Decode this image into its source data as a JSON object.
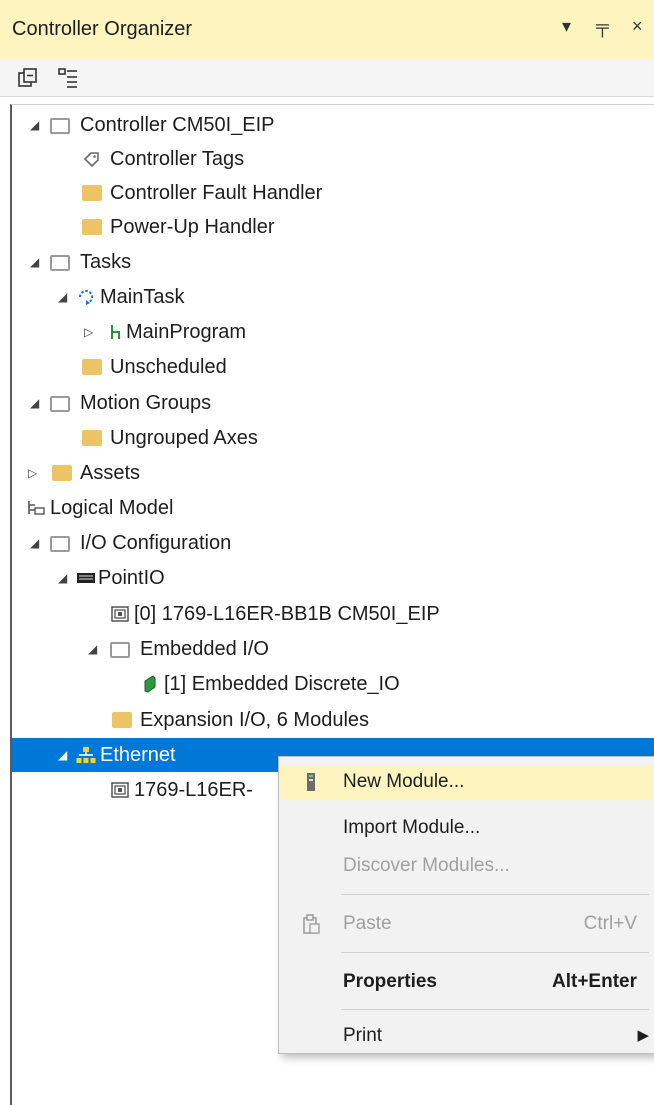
{
  "panel": {
    "title": "Controller Organizer",
    "controls": {
      "dropdown": "▾",
      "pin": "╤",
      "close": "×"
    }
  },
  "tree": [
    {
      "label": "Controller CM50I_EIP",
      "icon": "folder-open-icon",
      "expander": "expanded"
    },
    {
      "label": "Controller Tags",
      "icon": "tag-icon"
    },
    {
      "label": "Controller Fault Handler",
      "icon": "folder-icon"
    },
    {
      "label": "Power-Up Handler",
      "icon": "folder-icon"
    },
    {
      "label": "Tasks",
      "icon": "folder-open-icon",
      "expander": "expanded"
    },
    {
      "label": "MainTask",
      "icon": "continuous-task-icon",
      "expander": "expanded"
    },
    {
      "label": "MainProgram",
      "icon": "program-icon",
      "expander": "collapsed"
    },
    {
      "label": "Unscheduled",
      "icon": "folder-icon"
    },
    {
      "label": "Motion Groups",
      "icon": "folder-open-icon",
      "expander": "expanded"
    },
    {
      "label": "Ungrouped Axes",
      "icon": "folder-icon"
    },
    {
      "label": "Assets",
      "icon": "folder-icon",
      "expander": "collapsed"
    },
    {
      "label": "Logical Model",
      "icon": "logical-model-icon"
    },
    {
      "label": "I/O Configuration",
      "icon": "folder-open-icon",
      "expander": "expanded"
    },
    {
      "label": "PointIO",
      "icon": "backplane-icon",
      "expander": "expanded"
    },
    {
      "label": "[0] 1769-L16ER-BB1B CM50I_EIP",
      "icon": "controller-module-icon"
    },
    {
      "label": "Embedded I/O",
      "icon": "folder-open-icon",
      "expander": "expanded"
    },
    {
      "label": "[1] Embedded Discrete_IO",
      "icon": "io-module-icon"
    },
    {
      "label": "Expansion I/O, 6 Modules",
      "icon": "folder-icon"
    },
    {
      "label": "Ethernet",
      "icon": "network-icon",
      "expander": "expanded",
      "selected": true
    },
    {
      "label": "1769-L16ER-",
      "icon": "controller-module-icon"
    }
  ],
  "context_menu": {
    "items": [
      {
        "label": "New Module...",
        "icon": "module-icon",
        "highlighted": true
      },
      {
        "label": "Import Module..."
      },
      {
        "label": "Discover Modules...",
        "disabled": true
      },
      {
        "label": "Paste",
        "shortcut": "Ctrl+V",
        "icon": "paste-icon",
        "disabled": true
      },
      {
        "label": "Properties",
        "shortcut": "Alt+Enter",
        "bold": true
      },
      {
        "label": "Print",
        "submenu": "▶"
      }
    ]
  },
  "colors": {
    "title_bg": "#fdf4bf",
    "selection": "#0078d7",
    "menu_highlight": "#fdf4bf",
    "folder": "#ecc466"
  }
}
